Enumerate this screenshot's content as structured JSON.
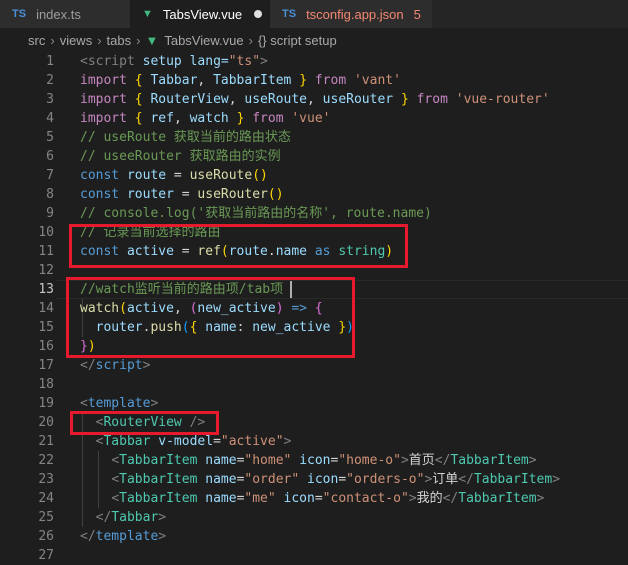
{
  "tabs": [
    {
      "icon": "TS",
      "label": "index.ts",
      "active": false
    },
    {
      "icon": "vue",
      "label": "TabsView.vue",
      "active": true,
      "modified": true
    },
    {
      "icon": "TS",
      "label": "tsconfig.app.json",
      "active": false,
      "problems": "5"
    }
  ],
  "breadcrumb": [
    "src",
    "views",
    "tabs",
    "TabsView.vue",
    "{} script setup"
  ],
  "current_line": 13,
  "line_numbers": [
    "1",
    "2",
    "3",
    "4",
    "5",
    "6",
    "7",
    "8",
    "9",
    "10",
    "11",
    "12",
    "13",
    "14",
    "15",
    "16",
    "17",
    "18",
    "19",
    "20",
    "21",
    "22",
    "23",
    "24",
    "25",
    "26",
    "27"
  ],
  "code": {
    "l1_tag": "<script",
    "l1_attr": " setup lang=",
    "l1_val": "\"ts\"",
    "l1_end": ">",
    "l2_from": "'vant'",
    "l3_from": "'vue-router'",
    "l4_from": "'vue'",
    "l5": "// useRoute 获取当前的路由状态",
    "l6": "// useeRouter 获取路由的实例",
    "l9": "// console.log('获取当前路由的名称', route.name)",
    "l10": "// 记录当前选择的路由",
    "l13": "//watch监听当前的路由项/tab项",
    "l21_text": "首页",
    "l22_text": "订单",
    "l23_text": "我的"
  },
  "colors": {
    "highlight_box": "#e51a2c",
    "editor_bg": "#1e1e1e"
  }
}
